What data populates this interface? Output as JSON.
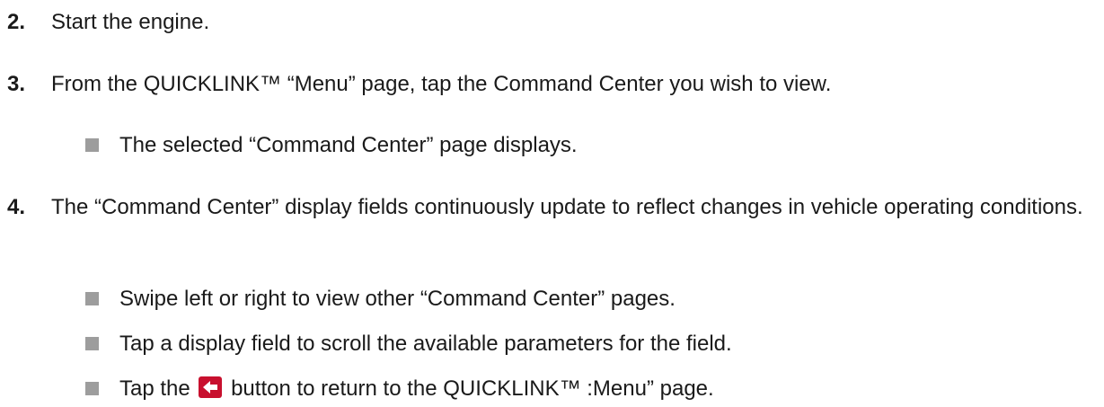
{
  "steps": [
    {
      "number": "2.",
      "text": "Start the engine."
    },
    {
      "number": "3.",
      "text": "From the QUICKLINK™ “Menu” page, tap the Command Center you wish to view."
    },
    {
      "number": "4.",
      "text": "The “Command Center” display fields continuously update to reflect changes in vehicle operating conditions."
    }
  ],
  "bullets": {
    "step3": [
      "The selected “Command Center” page displays."
    ],
    "step4": [
      "Swipe left or right to view other “Command Center” pages.",
      "Tap a display field to scroll the available parameters for the field."
    ],
    "back_bullet": {
      "before": "Tap the",
      "icon": "back-arrow-icon",
      "after": "button to return to the QUICKLINK™ :Menu” page."
    }
  },
  "colors": {
    "bullet": "#9d9d9d",
    "back_button": "#c8102e",
    "text": "#1a1a1a"
  }
}
